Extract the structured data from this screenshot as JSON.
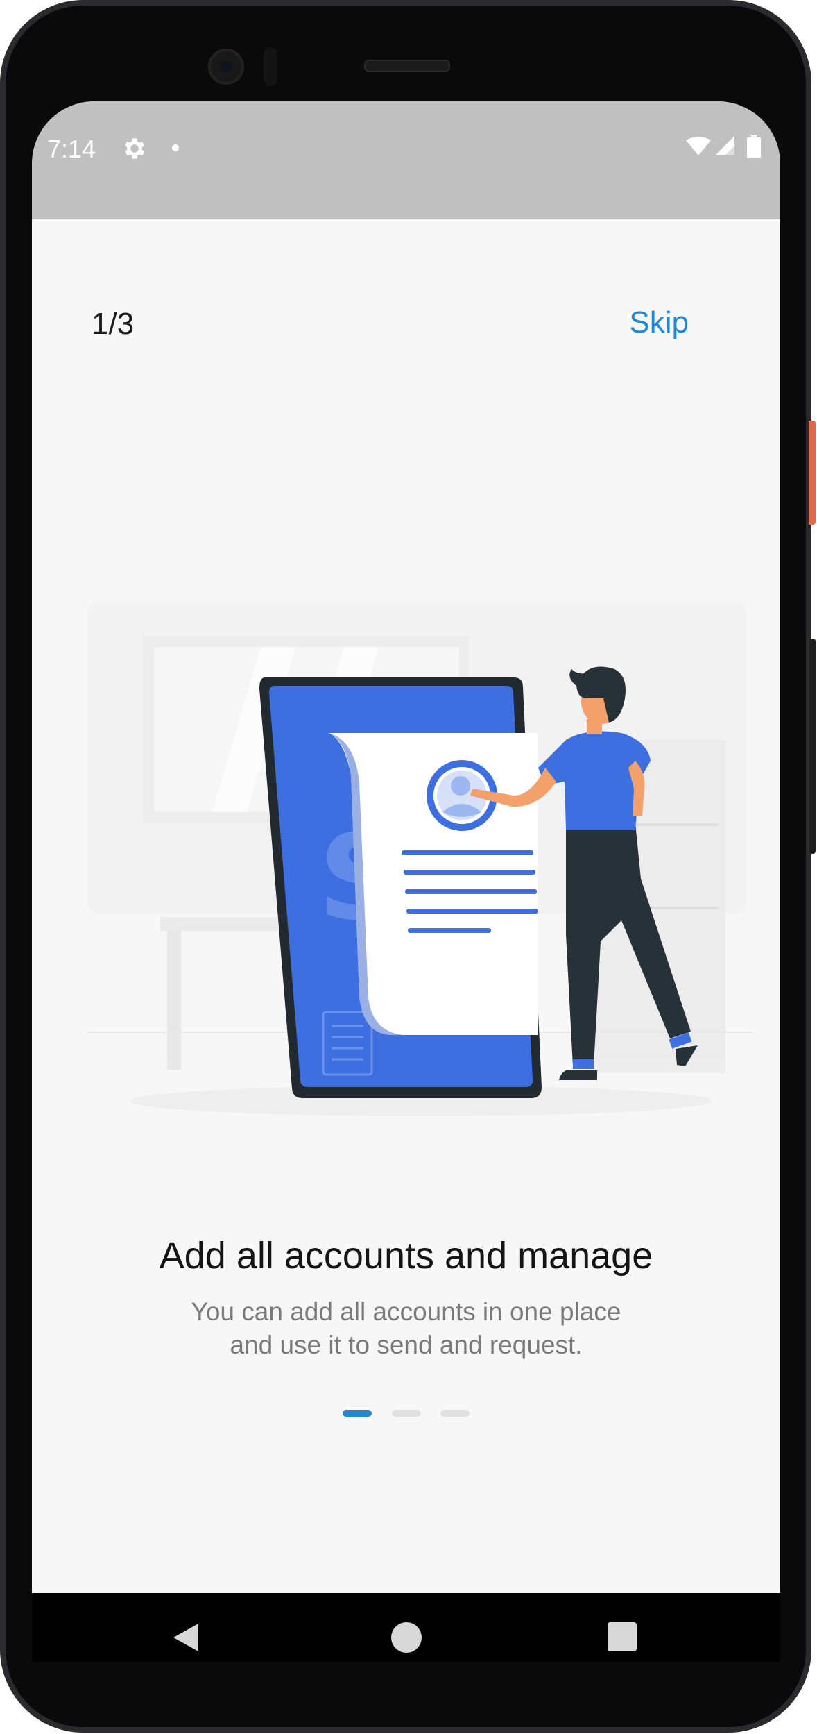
{
  "status_bar": {
    "time": "7:14",
    "icons": [
      "gear-icon",
      "notification-dot",
      "wifi-icon",
      "cellular-signal-icon",
      "battery-icon"
    ]
  },
  "onboarding": {
    "step_counter": "1/3",
    "skip_label": "Skip",
    "title": "Add all accounts and manage",
    "subtitle_line1": "You can add all accounts in one place",
    "subtitle_line2": "and use it to send and request.",
    "page_indicator": {
      "total": 3,
      "active_index": 0
    }
  },
  "navigation_bar": {
    "icons": [
      "back-icon",
      "home-icon",
      "recents-icon"
    ]
  },
  "colors": {
    "accent": "#1e87d8",
    "illustration_blue": "#3d6fe0",
    "status_bar": "#c0c0c0",
    "screen_background": "#f7f7f7"
  }
}
